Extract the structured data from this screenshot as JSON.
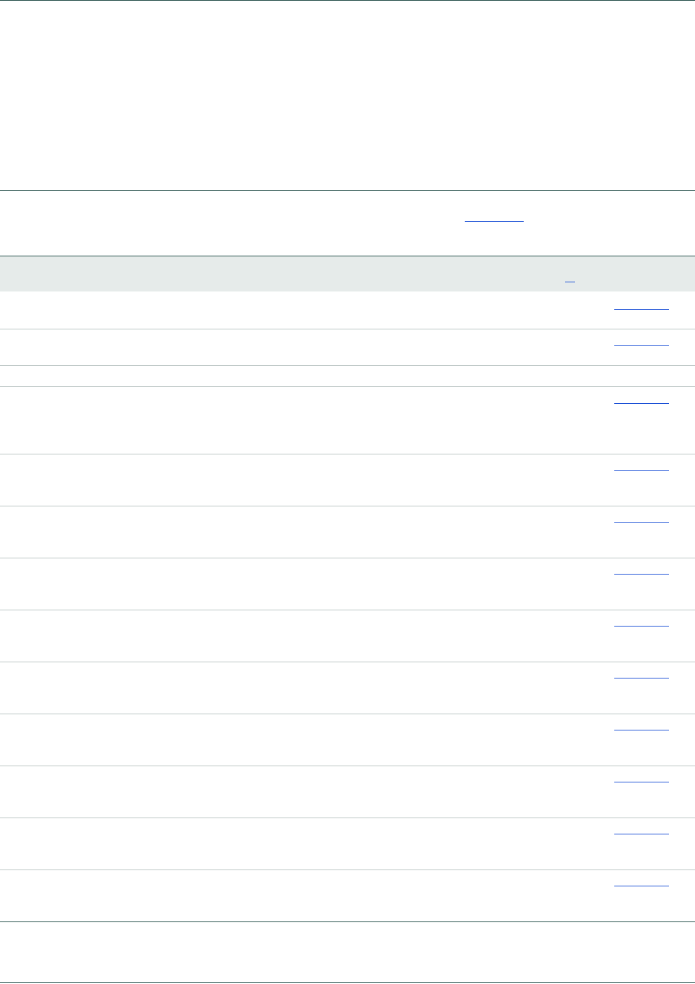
{
  "document": {
    "sections": [
      "top-block",
      "intro-block",
      "table",
      "footer-block"
    ],
    "table": {
      "header": {
        "has_footnote_link": true
      },
      "rows": [
        {
          "has_link": true
        },
        {
          "has_link": true
        },
        {
          "has_link": false
        },
        {
          "has_link": true
        },
        {
          "has_link": true
        },
        {
          "has_link": true
        },
        {
          "has_link": true
        },
        {
          "has_link": true
        },
        {
          "has_link": true
        },
        {
          "has_link": true
        },
        {
          "has_link": true
        },
        {
          "has_link": true
        },
        {
          "has_link": true
        }
      ]
    },
    "colors": {
      "rule_dark": "#1e4a45",
      "rule_light": "#b9c4c2",
      "header_band": "#e6ebea",
      "link": "#1a4fd6"
    }
  }
}
